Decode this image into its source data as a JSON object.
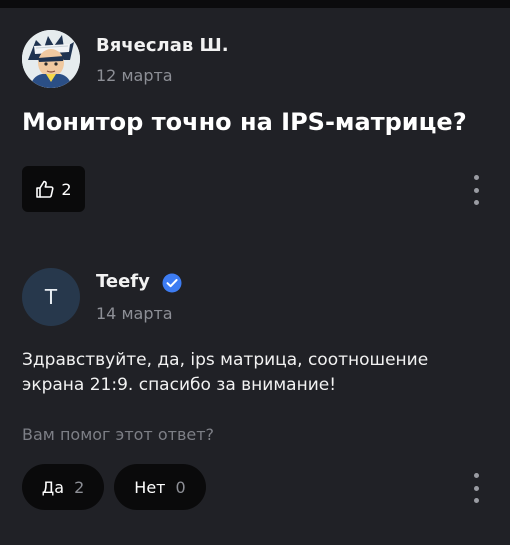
{
  "question": {
    "author": "Вячеслав Ш.",
    "date": "12 марта",
    "title": "Монитор точно на IPS-матрице?",
    "likes": "2"
  },
  "answer": {
    "avatar_letter": "T",
    "author": "Teefy",
    "date": "14 марта",
    "text": "Здравствуйте, да, ips матрица, соотношение экрана 21:9. спасибо за внимание!",
    "helpful_prompt": "Вам помог этот ответ?",
    "yes_label": "Да",
    "yes_count": "2",
    "no_label": "Нет",
    "no_count": "0"
  },
  "colors": {
    "background": "#202126",
    "button_bg": "#0a0a0b",
    "muted_text": "#8d8f96",
    "verified_badge": "#3d7cf2",
    "answer_avatar_bg": "#27384c"
  },
  "icons": {
    "like": "thumbs-up-icon",
    "more": "more-vertical-icon",
    "verified": "verified-check-icon"
  }
}
